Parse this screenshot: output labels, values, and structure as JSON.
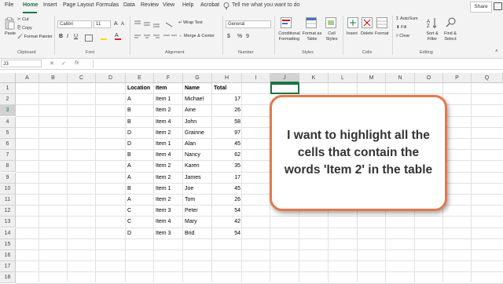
{
  "menu": {
    "tabs": [
      "File",
      "Home",
      "Insert",
      "Page Layout",
      "Formulas",
      "Data",
      "Review",
      "View",
      "Help",
      "Acrobat"
    ],
    "active_tab": "Home",
    "tell_me": "Tell me what you want to do",
    "share_label": "Share"
  },
  "ribbon": {
    "clipboard": {
      "paste": "Paste",
      "cut": "Cut",
      "copy": "Copy",
      "format_painter": "Format Painter",
      "label": "Clipboard"
    },
    "font": {
      "font_name": "Calibri",
      "font_size": "11",
      "bold": "B",
      "italic": "I",
      "underline": "U",
      "grow": "A",
      "shrink": "A",
      "label": "Font"
    },
    "alignment": {
      "wrap_text": "Wrap Text",
      "merge_center": "Merge & Center",
      "label": "Alignment"
    },
    "number": {
      "format": "General",
      "currency": "$",
      "percent": "%",
      "comma": "9",
      "label": "Number"
    },
    "styles": {
      "conditional": "Conditional Formatting",
      "format_table": "Format as Table",
      "cell_styles": "Cell Styles",
      "label": "Styles"
    },
    "cells": {
      "insert": "Insert",
      "delete": "Delete",
      "format": "Format",
      "label": "Cells"
    },
    "editing": {
      "autosum": "AutoSum",
      "fill": "Fill",
      "clear": "Clear",
      "sort": "Sort & Filter",
      "find": "Find & Select",
      "label": "Editing"
    }
  },
  "formula_bar": {
    "name_box": "J3",
    "cancel": "✕",
    "enter": "✓",
    "fx": "fx",
    "value": ""
  },
  "columns": [
    "A",
    "B",
    "C",
    "D",
    "E",
    "F",
    "G",
    "H",
    "I",
    "J",
    "K",
    "L",
    "M",
    "N",
    "O",
    "P",
    "Q"
  ],
  "selected_column": "J",
  "rows": [
    "1",
    "2",
    "3",
    "4",
    "5",
    "6",
    "7",
    "8",
    "9",
    "10",
    "11",
    "12",
    "13",
    "14",
    "15",
    "16",
    "17",
    "18"
  ],
  "selected_row": "3",
  "table": {
    "headers": [
      "Location",
      "Item",
      "Name",
      "Total"
    ],
    "rows": [
      [
        "A",
        "Item 1",
        "Michael",
        "17"
      ],
      [
        "B",
        "Item 2",
        "Aine",
        "26"
      ],
      [
        "B",
        "Item 4",
        "John",
        "58"
      ],
      [
        "D",
        "Item 2",
        "Grainne",
        "97"
      ],
      [
        "D",
        "Item 1",
        "Alan",
        "45"
      ],
      [
        "B",
        "Item 4",
        "Nancy",
        "62"
      ],
      [
        "A",
        "Item 2",
        "Karen",
        "35"
      ],
      [
        "A",
        "Item 2",
        "James",
        "17"
      ],
      [
        "B",
        "Item 1",
        "Joe",
        "45"
      ],
      [
        "A",
        "Item 2",
        "Tom",
        "26"
      ],
      [
        "C",
        "Item 3",
        "Peter",
        "54"
      ],
      [
        "C",
        "Item 4",
        "Mary",
        "42"
      ],
      [
        "D",
        "Item 3",
        "Brid",
        "54"
      ]
    ]
  },
  "callout": {
    "text": "I want to highlight all the cells that contain the words 'Item 2' in the table"
  },
  "colors": {
    "accent": "#217346",
    "callout_border": "#e07a4f"
  }
}
